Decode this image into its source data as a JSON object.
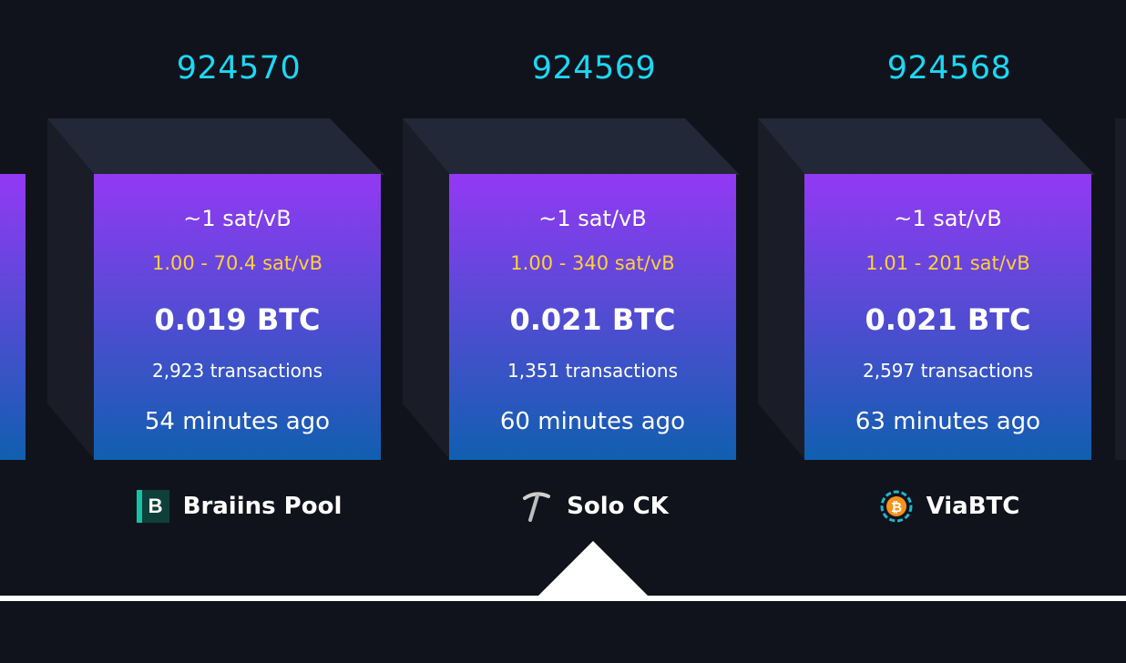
{
  "blocks": [
    {
      "height": "924570",
      "fee_median": "~1 sat/vB",
      "fee_range": "1.00 - 70.4 sat/vB",
      "reward": "0.019 BTC",
      "tx_count": "2,923 transactions",
      "time_ago": "54 minutes ago",
      "pool_name": "Braiins Pool",
      "pool_icon": "braiins-logo-icon",
      "pool_logo_letter": "B"
    },
    {
      "height": "924569",
      "fee_median": "~1 sat/vB",
      "fee_range": "1.00 - 340 sat/vB",
      "reward": "0.021 BTC",
      "tx_count": "1,351 transactions",
      "time_ago": "60 minutes ago",
      "pool_name": "Solo CK",
      "pool_icon": "pickaxe-icon"
    },
    {
      "height": "924568",
      "fee_median": "~1 sat/vB",
      "fee_range": "1.01 - 201 sat/vB",
      "reward": "0.021 BTC",
      "tx_count": "2,597 transactions",
      "time_ago": "63 minutes ago",
      "pool_name": "ViaBTC",
      "pool_icon": "viabtc-logo-icon"
    }
  ],
  "selected_block": "924569",
  "colors": {
    "background": "#11131c",
    "height_text": "#1bd8f4",
    "fee_range_text": "#ffd13a",
    "gradient_top": "#9339f4",
    "gradient_bottom": "#105fb0"
  }
}
